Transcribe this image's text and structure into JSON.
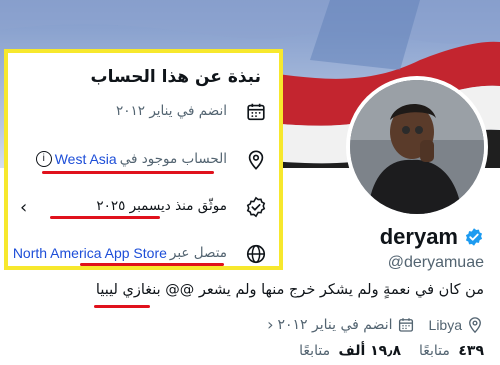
{
  "profile": {
    "display_name": "deryam",
    "handle": "@deryamuae",
    "bio_text": "من كان في نعمةٍ ولم يشكر خرج منها ولم يشعر @@",
    "bio_location": "بنغازي ليبيا",
    "location": "Libya",
    "joined": "انضم في يناير ٢٠١٢",
    "following_count": "٤٣٩",
    "following_label": "متابعًا",
    "followers_count": "١٩٫٨ ألف",
    "followers_label": "متابعًا"
  },
  "about": {
    "title": "نبذة عن هذا الحساب",
    "joined": "انضم في يناير ٢٠١٢",
    "location_prefix": "الحساب موجود في",
    "location_value": "West Asia",
    "verified_since": "موثّق منذ ديسمبر ٢٠٢٥",
    "connected_prefix": "متصل عبر",
    "connected_value": "North America App Store"
  },
  "colors": {
    "highlight_border": "#f7e82d",
    "annotation_red": "#e0111c",
    "verified_blue": "#1d9bf0",
    "link_blue": "#1d4ed8"
  },
  "icons": {
    "calendar": "calendar-icon",
    "location": "location-pin-icon",
    "verified": "verified-badge-icon",
    "globe": "globe-icon"
  }
}
